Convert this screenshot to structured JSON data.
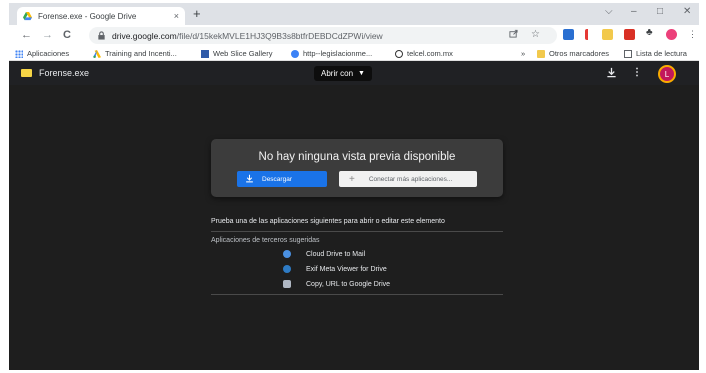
{
  "browser": {
    "tab": {
      "title": "Forense.exe - Google Drive",
      "close": "×"
    },
    "new_tab": "+",
    "window_controls": {
      "dropdown": "⌵",
      "minimize": "–",
      "maximize": "□",
      "close": "✕"
    },
    "nav": {
      "back": "←",
      "forward": "→",
      "reload": "C"
    },
    "address": {
      "host": "drive.google.com",
      "path": "/file/d/15kekMVLE1HJ3Q9B3s8btfrDEBDCdZPWi/view"
    },
    "more_menu": "⋮"
  },
  "bookmarks": {
    "items": [
      {
        "label": "Aplicaciones",
        "icon": "apps-grid-icon",
        "color": "#4285f4"
      },
      {
        "label": "Training and Incenti...",
        "icon": "google-ads-icon",
        "color": "#fbbc04"
      },
      {
        "label": "Web Slice Gallery",
        "icon": "slice-icon",
        "color": "#2f5aa8"
      },
      {
        "label": "http--legislacionme...",
        "icon": "globe-icon",
        "color": "#3b82f6"
      },
      {
        "label": "telcel.com.mx",
        "icon": "telcel-icon",
        "color": "#333333"
      }
    ],
    "overflow": "»",
    "other": "Otros marcadores",
    "reading_list": "Lista de lectura"
  },
  "drive": {
    "file_name": "Forense.exe",
    "open_with": "Abrir con",
    "avatar_letter": "L",
    "no_preview": "No hay ninguna vista previa disponible",
    "download_label": "Descargar",
    "connect_label": "Conectar más aplicaciones...",
    "suggest_text": "Prueba una de las aplicaciones siguientes para abrir o editar este elemento",
    "third_party_label": "Aplicaciones de terceros sugeridas",
    "apps": [
      {
        "name": "Cloud Drive to Mail",
        "icon": "cloud-drive-mail-icon",
        "color": "#4a90e2"
      },
      {
        "name": "Exif Meta Viewer for Drive",
        "icon": "exif-viewer-icon",
        "color": "#2e7bc4"
      },
      {
        "name": "Copy, URL to Google Drive",
        "icon": "copy-url-drive-icon",
        "color": "#b0b8c4"
      }
    ]
  }
}
